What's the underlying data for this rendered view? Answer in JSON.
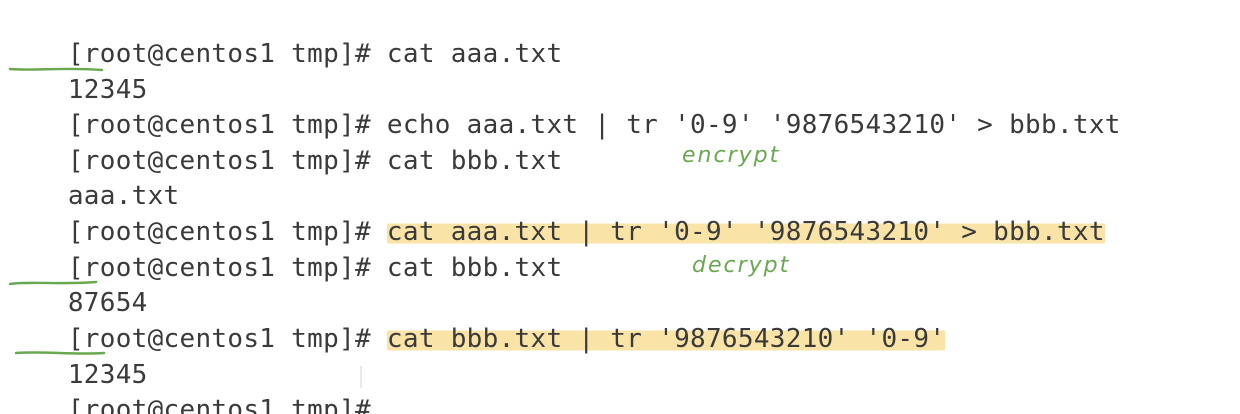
{
  "terminal": {
    "lines": [
      {
        "prompt": "[root@centos1 tmp]# ",
        "command": "cat aaa.txt"
      },
      {
        "output": "12345"
      },
      {
        "prompt": "[root@centos1 tmp]# ",
        "command": "echo aaa.txt | tr '0-9' '9876543210' > bbb.txt"
      },
      {
        "prompt": "[root@centos1 tmp]# ",
        "command": "cat bbb.txt"
      },
      {
        "output": "aaa.txt"
      },
      {
        "prompt": "[root@centos1 tmp]# ",
        "command": "cat aaa.txt | tr '0-9' '9876543210' > bbb.txt"
      },
      {
        "prompt": "[root@centos1 tmp]# ",
        "command": "cat bbb.txt"
      },
      {
        "output": "87654"
      },
      {
        "prompt": "[root@centos1 tmp]# ",
        "command": "cat bbb.txt | tr '9876543210' '0-9'"
      },
      {
        "output": "12345"
      },
      {
        "prompt": "[root@centos1 tmp]# ",
        "command": ""
      }
    ]
  },
  "annotations": {
    "encrypt_label": "encrypt",
    "decrypt_label": "decrypt",
    "highlight_color": "#f9e3a6",
    "ink_color": "#6aa84f"
  }
}
